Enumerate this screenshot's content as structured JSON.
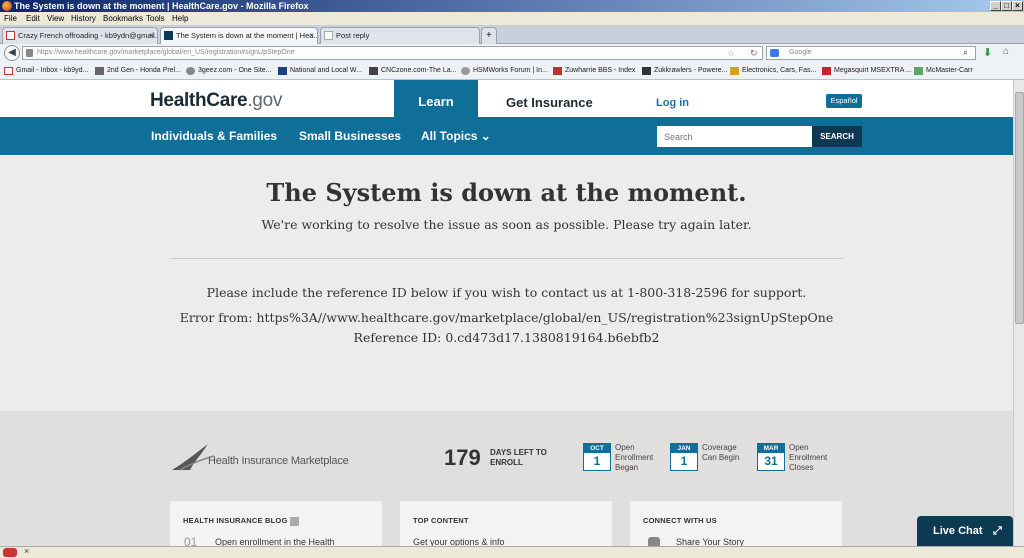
{
  "window": {
    "title": "The System is down at the moment | HealthCare.gov - Mozilla Firefox",
    "min_label": "_",
    "max_label": "□",
    "close_label": "×"
  },
  "menu": [
    "File",
    "Edit",
    "View",
    "History",
    "Bookmarks",
    "Tools",
    "Help"
  ],
  "tabs": [
    {
      "label": "Crazy French offroading - kb9ydn@gmail...",
      "close": "×"
    },
    {
      "label": "The System is down at the moment | Hea...",
      "close": "×"
    },
    {
      "label": "Post reply",
      "close": ""
    }
  ],
  "new_tab_label": "+",
  "url": "https://www.healthcare.gov/marketplace/global/en_US/registration#signUpStepOne",
  "search_placeholder": "Google",
  "bookmarks": [
    "Gmail - Inbox - kb9yd...",
    "2nd Gen - Honda Prel...",
    "3geez.com - One Site...",
    "National and Local W...",
    "CNCzone.com-The La...",
    "HSMWorks Forum | In...",
    "Zuwharrie BBS - Index",
    "Zukkrawlers - Powere...",
    "Electronics, Cars, Fas...",
    "Megasquirt MSEXTRA ...",
    "McMaster-Carr"
  ],
  "site": {
    "logo_main": "HealthCare",
    "logo_dot": ".gov",
    "learn": "Learn",
    "get_insurance": "Get Insurance",
    "login": "Log in",
    "espanol": "Español",
    "nav": [
      "Individuals & Families",
      "Small Businesses",
      "All Topics"
    ],
    "all_topics_caret": "⌄",
    "search_placeholder": "Search",
    "search_button": "SEARCH"
  },
  "error": {
    "title": "The System is down at the moment.",
    "subtitle": "We're working to resolve the issue as soon as possible. Please try again later.",
    "support": "Please include the reference ID below if you wish to contact us at 1-800-318-2596 for support.",
    "error_from": "Error from: https%3A//www.healthcare.gov/marketplace/global/en_US/registration%23signUpStepOne",
    "reference": "Reference ID: 0.cd473d17.1380819164.b6ebfb2"
  },
  "footer": {
    "marketplace": "Health Insurance Marketplace",
    "days_num": "179",
    "days_label": "DAYS LEFT TO ENROLL",
    "calendars": [
      {
        "month": "OCT",
        "day": "1",
        "text": "Open Enrollment Began"
      },
      {
        "month": "JAN",
        "day": "1",
        "text": "Coverage Can Begin"
      },
      {
        "month": "MAR",
        "day": "31",
        "text": "Open Enrollment Closes"
      }
    ],
    "cards": [
      {
        "heading": "HEALTH INSURANCE BLOG",
        "number": "01",
        "text": "Open enrollment in the Health"
      },
      {
        "heading": "TOP CONTENT",
        "text": "Get your options & info"
      },
      {
        "heading": "CONNECT WITH US",
        "text": "Share Your Story"
      }
    ],
    "live_chat": "Live Chat"
  },
  "colors": {
    "accent": "#106f98",
    "dark": "#0b3a52",
    "error_bg": "#eeecea"
  }
}
